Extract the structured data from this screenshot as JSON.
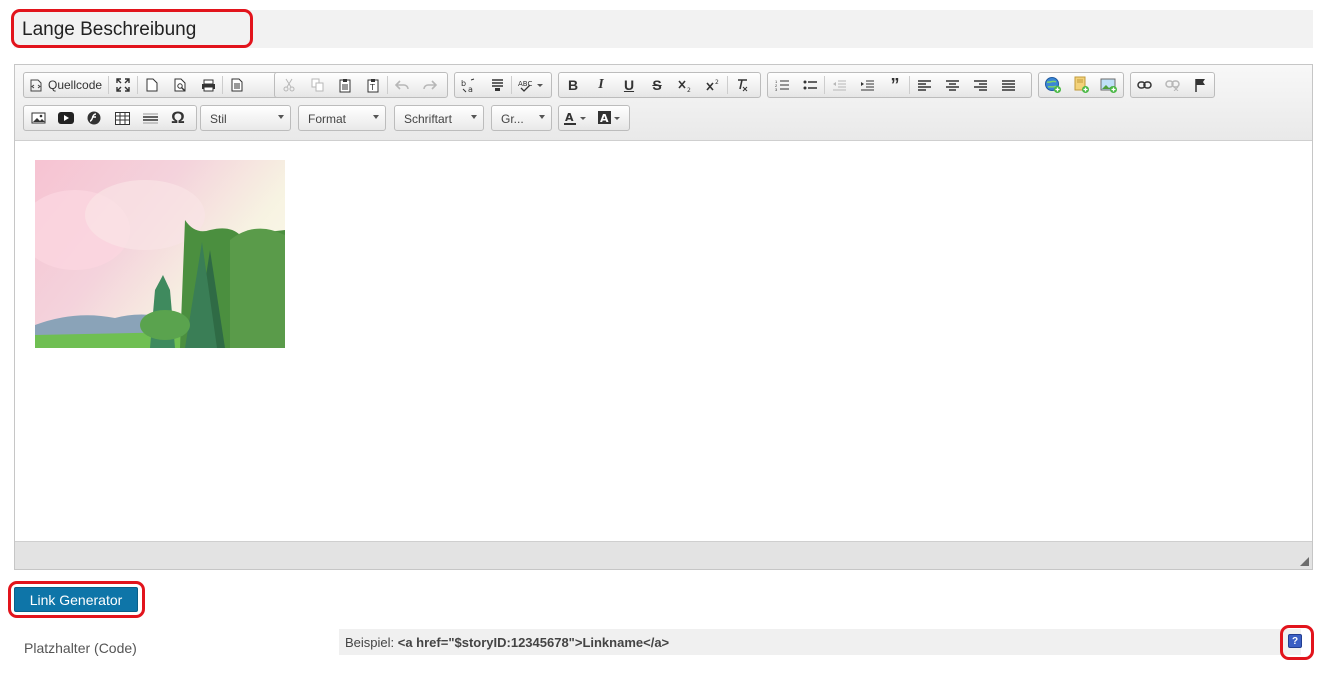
{
  "section": {
    "title": "Lange Beschreibung"
  },
  "toolbar": {
    "source_label": "Quellcode",
    "combos": {
      "style": "Stil",
      "format": "Format",
      "font": "Schriftart",
      "size": "Gr..."
    }
  },
  "buttons": {
    "link_generator": "Link Generator"
  },
  "placeholder": {
    "label": "Platzhalter (Code)",
    "example_prefix": "Beispiel: ",
    "example_code": "<a href=\"$storyID:12345678\">Linkname</a>"
  },
  "help": {
    "glyph": "?"
  },
  "colors": {
    "accent": "#0e75a8",
    "highlight_ring": "#e2141c",
    "help_icon": "#3b5fc4"
  }
}
